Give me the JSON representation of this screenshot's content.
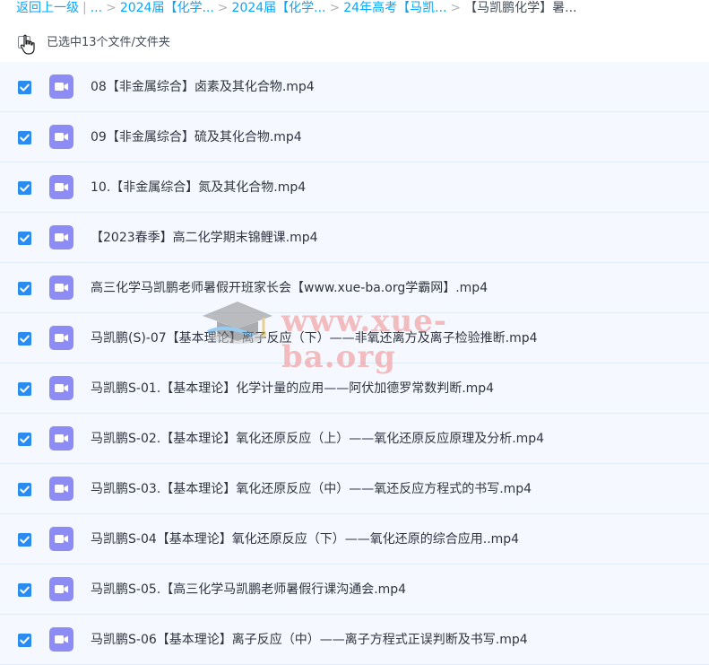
{
  "breadcrumb": {
    "back": "返回上一级",
    "ellipsis": "...",
    "crumbs": [
      "2024届【化学...",
      "2024届【化学...",
      "24年高考【马凯...",
      "【马凯鹏化学】暑..."
    ]
  },
  "selection": {
    "status": "已选中13个文件/文件夹"
  },
  "watermark": {
    "text": "www.xue-ba.org"
  },
  "files": [
    {
      "name": "08【非金属综合】卤素及其化合物.mp4",
      "icon": "video-file-icon",
      "checked": true
    },
    {
      "name": "09【非金属综合】硫及其化合物.mp4",
      "icon": "video-file-icon",
      "checked": true
    },
    {
      "name": "10.【非金属综合】氮及其化合物.mp4",
      "icon": "video-file-icon",
      "checked": true
    },
    {
      "name": "【2023春季】高二化学期末锦鲤课.mp4",
      "icon": "video-file-icon",
      "checked": true
    },
    {
      "name": "高三化学马凯鹏老师暑假开班家长会【www.xue-ba.org学霸网】.mp4",
      "icon": "video-file-icon",
      "checked": true
    },
    {
      "name": "马凯鹏(S)-07【基本理论】离子反应（下）——非氧还离方及离子检验推断.mp4",
      "icon": "video-file-icon",
      "checked": true
    },
    {
      "name": "马凯鹏S-01.【基本理论】化学计量的应用——阿伏加德罗常数判断.mp4",
      "icon": "video-file-icon",
      "checked": true
    },
    {
      "name": "马凯鹏S-02.【基本理论】氧化还原反应（上）——氧化还原反应原理及分析.mp4",
      "icon": "video-file-icon",
      "checked": true
    },
    {
      "name": "马凯鹏S-03.【基本理论】氧化还原反应（中）——氧还反应方程式的书写.mp4",
      "icon": "video-file-icon",
      "checked": true
    },
    {
      "name": "马凯鹏S-04【基本理论】氧化还原反应（下）——氧化还原的综合应用..mp4",
      "icon": "video-file-icon",
      "checked": true
    },
    {
      "name": "马凯鹏S-05.【高三化学马凯鹏老师暑假行课沟通会.mp4",
      "icon": "video-file-icon",
      "checked": true
    },
    {
      "name": "马凯鹏S-06【基本理论】离子反应（中）——离子方程式正误判断及书写.mp4",
      "icon": "video-file-icon",
      "checked": true
    }
  ],
  "colors": {
    "accent": "#06a7ff",
    "checkbox": "#2a8cf0",
    "video_icon": "#8d8cf5",
    "row_bg": "#f5f9ff"
  }
}
